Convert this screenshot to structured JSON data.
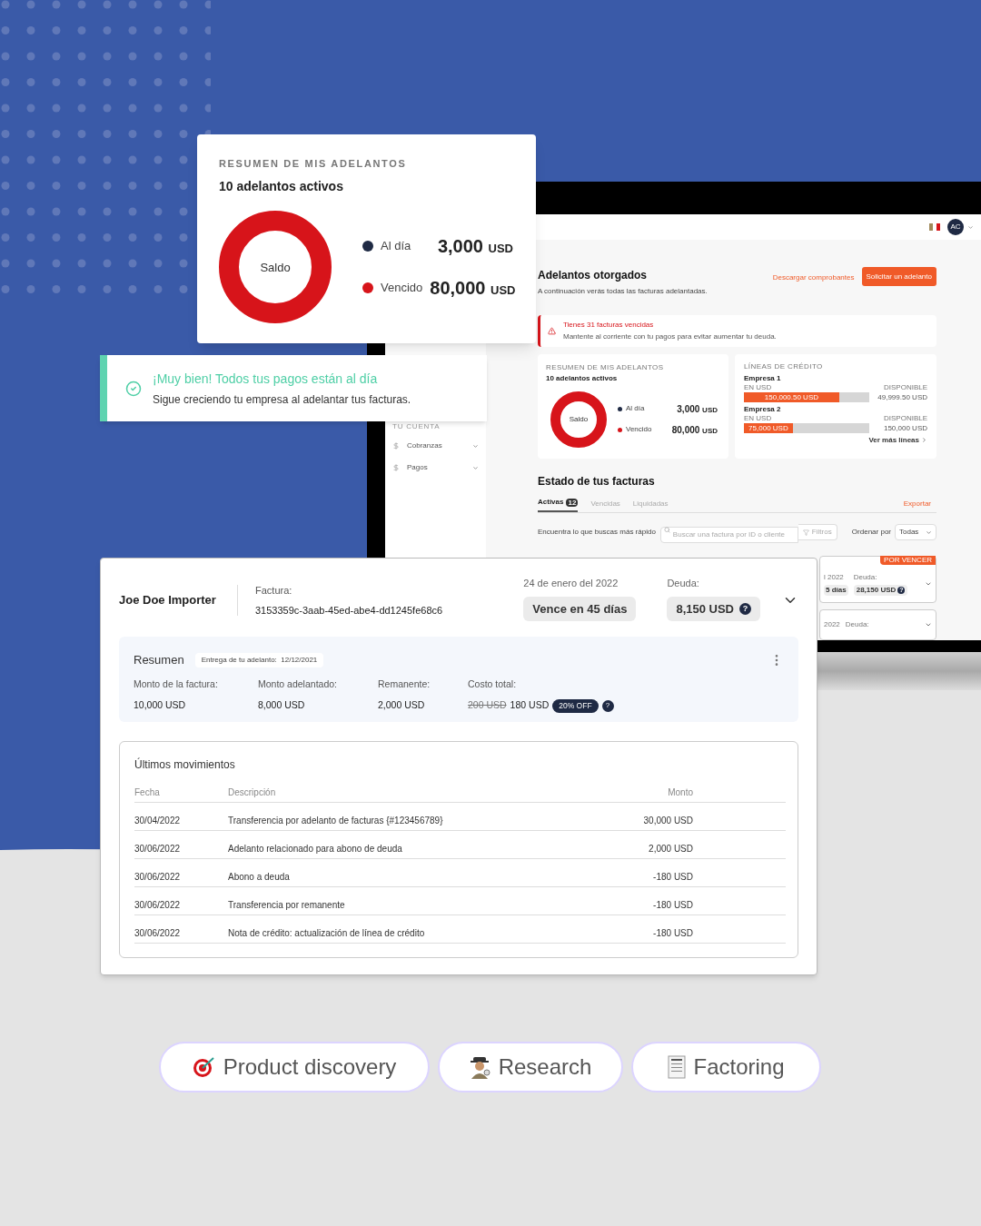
{
  "summary_card": {
    "title": "RESUMEN DE MIS ADELANTOS",
    "subtitle": "10 adelantos activos",
    "donut_label": "Saldo",
    "legend": [
      {
        "label": "Al día",
        "amount": "3,000",
        "unit": "USD",
        "color": "#1f2a44"
      },
      {
        "label": "Vencido",
        "amount": "80,000",
        "unit": "USD",
        "color": "#d7141a"
      }
    ]
  },
  "success_banner": {
    "title": "¡Muy bien! Todos tus pagos están al día",
    "message": "Sigue creciendo tu empresa al adelantar tus facturas."
  },
  "laptop": {
    "header": {
      "avatar": "AC"
    },
    "sidebar": {
      "section": "TU CUENTA",
      "items": [
        {
          "label": "Cobranzas"
        },
        {
          "label": "Pagos"
        }
      ]
    },
    "page_title": "Adelantos otorgados",
    "page_subtitle": "A continuación verás todas las facturas adelantadas.",
    "download_link": "Descargar comprobantes",
    "request_button": "Solicitar un adelanto",
    "alert": {
      "title": "Tienes 31 facturas vencidas",
      "message": "Mantente al corriente con tu pagos para evitar aumentar tu deuda."
    },
    "summary": {
      "title": "RESUMEN DE MIS ADELANTOS",
      "subtitle": "10 adelantos activos",
      "donut_label": "Saldo",
      "legend": [
        {
          "label": "Al día",
          "amount": "3,000",
          "unit": "USD",
          "color": "#1f2a44"
        },
        {
          "label": "Vencido",
          "amount": "80,000",
          "unit": "USD",
          "color": "#d7141a"
        }
      ]
    },
    "credit_lines": {
      "title": "LÍNEAS DE CRÉDITO",
      "lines": [
        {
          "name": "Empresa 1",
          "currency": "EN USD",
          "used": "150,000.50 USD",
          "level": 0.76,
          "available_label": "DISPONIBLE",
          "available": "49,999.50 USD"
        },
        {
          "name": "Empresa 2",
          "currency": "EN USD",
          "used": "75,000 USD",
          "level": 0.39,
          "available_label": "DISPONIBLE",
          "available": "150,000 USD"
        }
      ],
      "more_link": "Ver más líneas"
    },
    "invoices_title": "Estado de tus facturas",
    "tabs": [
      {
        "label": "Activas",
        "count": "12",
        "selected": true
      },
      {
        "label": "Vencidas",
        "selected": false
      },
      {
        "label": "Liquidadas",
        "selected": false
      }
    ],
    "export_link": "Exportar",
    "search_hint": "Encuentra lo que buscas más rápido",
    "search": {
      "placeholder": "Buscar una factura por ID o cliente"
    },
    "filters_button": "Filtros",
    "sort_label": "Ordenar por",
    "sort_value": "Todas",
    "background_invoices": [
      {
        "date": "l 2022",
        "status": "5 días",
        "debt_label": "Deuda:",
        "debt": "28,150 USD",
        "help_mark": "?",
        "badge": "POR VENCER"
      },
      {
        "date": "2022",
        "debt_label": "Deuda:"
      }
    ]
  },
  "invoice_card": {
    "company": "Joe Doe Importer",
    "invoice_label": "Factura:",
    "invoice_id": "3153359c-3aab-45ed-abe4-dd1245fe68c6",
    "date": "24 de enero del 2022",
    "due": "Vence en 45 días",
    "debt_label": "Deuda:",
    "debt": "8,150 USD",
    "help_mark": "?",
    "summary": {
      "title": "Resumen",
      "delivery_label": "Entrega de tu adelanto:",
      "delivery_date": "12/12/2021",
      "fields": [
        {
          "label": "Monto de la factura:",
          "value": "10,000 USD"
        },
        {
          "label": "Monto adelantado:",
          "value": "8,000 USD"
        },
        {
          "label": "Remanente:",
          "value": "2,000 USD"
        }
      ],
      "cost_label": "Costo total:",
      "cost_old": "200 USD",
      "cost_new": "180 USD",
      "discount": "20% OFF",
      "help_mark": "?"
    },
    "movements": {
      "title": "Últimos movimientos",
      "columns": [
        "Fecha",
        "Descripción",
        "Monto"
      ],
      "rows": [
        [
          "30/04/2022",
          "Transferencia por adelanto de facturas {#123456789}",
          "30,000 USD"
        ],
        [
          "30/06/2022",
          "Adelanto relacionado para abono de deuda",
          "2,000 USD"
        ],
        [
          "30/06/2022",
          "Abono a deuda",
          "-180 USD"
        ],
        [
          "30/06/2022",
          "Transferencia por remanente",
          "-180 USD"
        ],
        [
          "30/06/2022",
          "Nota de crédito: actualización de línea de crédito",
          "-180 USD"
        ]
      ]
    }
  },
  "tags": [
    {
      "kind": "target",
      "label": "Product discovery"
    },
    {
      "kind": "detective",
      "label": "Research"
    },
    {
      "kind": "receipt",
      "label": "Factoring"
    }
  ]
}
